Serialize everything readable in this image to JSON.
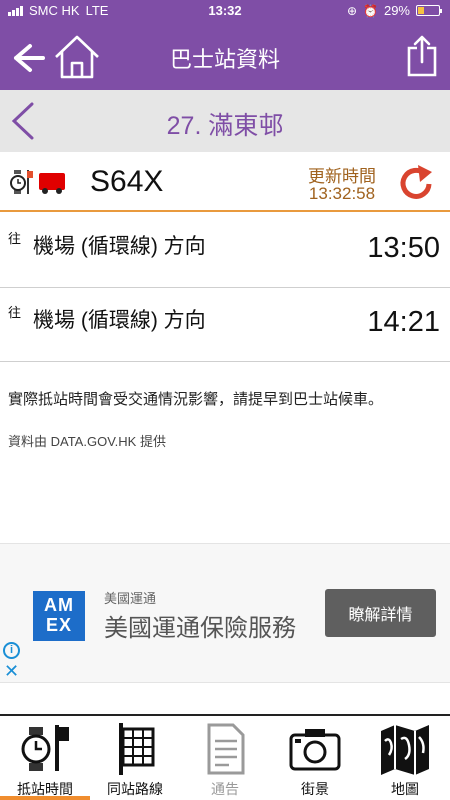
{
  "status_bar": {
    "carrier": "SMC HK",
    "network": "LTE",
    "time": "13:32",
    "battery": "29%"
  },
  "nav": {
    "title": "巴士站資料"
  },
  "stop": {
    "name": "27. 滿東邨"
  },
  "route": {
    "number": "S64X",
    "update_label": "更新時間",
    "update_time": "13:32:58"
  },
  "etas": [
    {
      "to": "往",
      "destination": "機場 (循環線) 方向",
      "time": "13:50"
    },
    {
      "to": "往",
      "destination": "機場 (循環線) 方向",
      "time": "14:21"
    }
  ],
  "notice": "實際抵站時間會受交通情況影響，請提早到巴士站候車。",
  "source": "資料由 DATA.GOV.HK 提供",
  "ad": {
    "logo_line1": "AM",
    "logo_line2": "EX",
    "brand": "美國運通",
    "headline": "美國運通保險服務",
    "cta": "瞭解詳情"
  },
  "tabs": [
    {
      "label": "抵站時間"
    },
    {
      "label": "同站路線"
    },
    {
      "label": "通告"
    },
    {
      "label": "街景"
    },
    {
      "label": "地圖"
    }
  ],
  "colors": {
    "primary": "#7f4ea6",
    "accent": "#e99a3d",
    "refresh": "#d9442f"
  }
}
